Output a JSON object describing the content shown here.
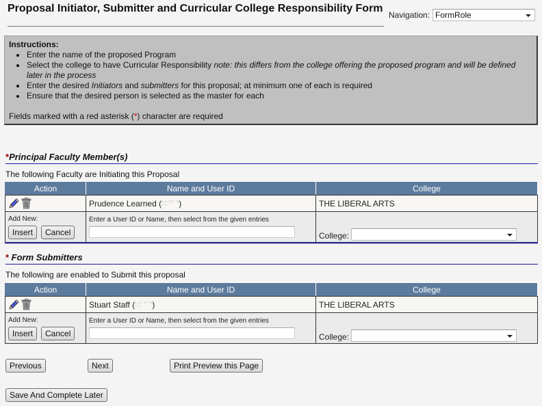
{
  "page": {
    "title": "Proposal Initiator, Submitter and Curricular College Responsibility Form",
    "navigation_label": "Navigation:",
    "navigation_value": "FormRole"
  },
  "instructions": {
    "heading": "Instructions:",
    "items": [
      {
        "text": "Enter the name of the proposed Program"
      },
      {
        "text": "Select the college to have Curricular Responsibility ",
        "note": "note: this differs from the college offering the proposed program and will be defined later in the process"
      },
      {
        "pre": "Enter the desired ",
        "em1": "Initiators",
        "mid": " and ",
        "em2": "submitters",
        "post": " for this proposal; at minimum one of each is required"
      },
      {
        "text": "Ensure that the desired person is selected as the master for each"
      }
    ],
    "required_pre": "Fields marked with a red asterisk (",
    "required_star": "*",
    "required_post": ") character are required"
  },
  "faculty": {
    "star": "*",
    "heading": "Principal Faculty Member(s)",
    "description": "The following Faculty are Initiating this Proposal",
    "columns": [
      "Action",
      "Name and User ID",
      "College"
    ],
    "rows": [
      {
        "name": "Prudence Learned (",
        "user_id": "∷´′˙′",
        "close": ")",
        "college": "THE LIBERAL ARTS"
      }
    ],
    "add_new_label": "Add New:",
    "insert_label": "Insert",
    "cancel_label": "Cancel",
    "hint": "Enter a User ID or Name, then select from the given entries",
    "input_value": "",
    "college_label": "College:",
    "college_value": ""
  },
  "submitters": {
    "star": "*",
    "heading": " Form Submitters",
    "description": "The following are enabled to Submit this proposal",
    "columns": [
      "Action",
      "Name and User ID",
      "College"
    ],
    "rows": [
      {
        "name": "Stuart Staff (",
        "user_id": "∷˙′˙′",
        "close": ")",
        "college": "THE LIBERAL ARTS"
      }
    ],
    "add_new_label": "Add New:",
    "insert_label": "Insert",
    "cancel_label": "Cancel",
    "hint": "Enter a User ID or Name, then select from the given entries",
    "input_value": "",
    "college_label": "College:",
    "college_value": ""
  },
  "footer": {
    "previous_label": "Previous",
    "next_label": "Next",
    "print_label": "Print Preview this Page",
    "save_label": "Save And Complete Later"
  },
  "colors": {
    "header_bg": "#5d7b9d",
    "instructions_bg": "#c0c0c0",
    "section_rule": "#1a1aa0",
    "required_star": "#cc0000"
  }
}
